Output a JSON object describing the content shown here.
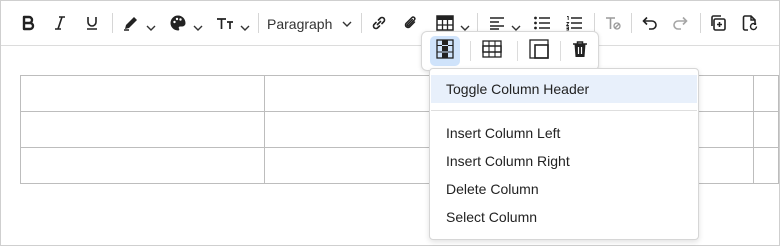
{
  "toolbar": {
    "buttons": [
      {
        "icon": "bold-icon"
      },
      {
        "icon": "italic-icon"
      },
      {
        "icon": "underline-icon"
      },
      {
        "icon": "highlighter-pen-icon"
      },
      {
        "icon": "palette-icon"
      },
      {
        "icon": "font-size-icon"
      },
      {
        "icon": "link-icon"
      },
      {
        "icon": "attachment-icon"
      },
      {
        "icon": "table-icon"
      },
      {
        "icon": "align-left-icon"
      },
      {
        "icon": "bullet-list-icon"
      },
      {
        "icon": "numbered-list-icon"
      },
      {
        "icon": "clear-formatting-icon"
      },
      {
        "icon": "undo-icon"
      },
      {
        "icon": "redo-icon"
      },
      {
        "icon": "duplicate-icon"
      },
      {
        "icon": "file-sync-icon"
      }
    ],
    "block_format": "Paragraph"
  },
  "table_toolbar": {
    "buttons": [
      {
        "icon": "column-icon",
        "active": true
      },
      {
        "icon": "row-icon",
        "active": false
      },
      {
        "icon": "cell-icon",
        "active": false
      },
      {
        "icon": "delete-table-icon",
        "active": false
      }
    ]
  },
  "column_menu": {
    "items": [
      {
        "label": "Toggle Column Header",
        "highlighted": true
      },
      {
        "label": "Insert Column Left",
        "highlighted": false
      },
      {
        "label": "Insert Column Right",
        "highlighted": false
      },
      {
        "label": "Delete Column",
        "highlighted": false
      },
      {
        "label": "Select Column",
        "highlighted": false
      }
    ]
  },
  "table": {
    "rows": 3,
    "columns": 3
  },
  "colors": {
    "active_button_bg": "#cfe3fb",
    "menu_highlight_bg": "#e8f0fb",
    "border": "#bdbdbd"
  }
}
